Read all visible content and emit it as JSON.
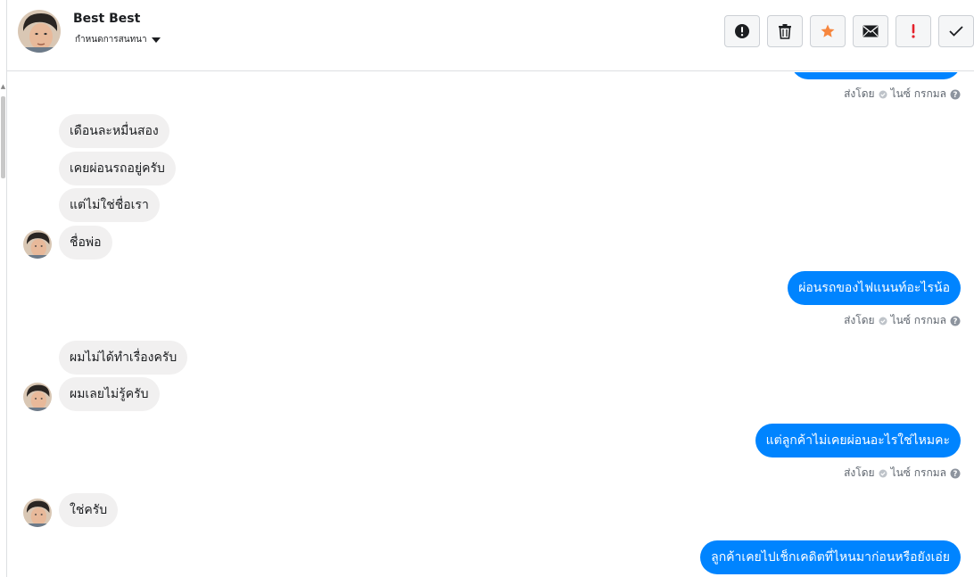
{
  "header": {
    "contact_name": "Best Best",
    "assign_label": "กำหนดการสนทนา"
  },
  "actions": [
    {
      "name": "spam-button",
      "icon": "exclamation-circle-icon"
    },
    {
      "name": "delete-button",
      "icon": "trash-icon"
    },
    {
      "name": "star-button",
      "icon": "star-icon"
    },
    {
      "name": "mark-unread-button",
      "icon": "envelope-icon"
    },
    {
      "name": "follow-up-button",
      "icon": "exclamation-icon"
    },
    {
      "name": "mark-done-button",
      "icon": "check-icon"
    }
  ],
  "colors": {
    "accent": "#0084ff",
    "incoming_bubble": "#f1f0f0",
    "star": "#f6863e",
    "follow_up": "#e4212b"
  },
  "messages": [
    {
      "from": "page",
      "text": "",
      "meta": {
        "sent_by": "ส่งโดย",
        "sender": "ไนซ์ กรกมล"
      }
    },
    {
      "from": "customer",
      "text": "เดือนละหมื่นสอง"
    },
    {
      "from": "customer",
      "text": "เคยผ่อนรถอยู่ครับ"
    },
    {
      "from": "customer",
      "text": "แต่ไม่ใช่ชื่อเรา"
    },
    {
      "from": "customer",
      "text": "ชื่อพ่อ"
    },
    {
      "from": "page",
      "text": "ผ่อนรถของไฟแนนท์อะไรน้อ",
      "meta": {
        "sent_by": "ส่งโดย",
        "sender": "ไนซ์ กรกมล"
      }
    },
    {
      "from": "customer",
      "text": "ผมไม่ได้ทำเรื่องครับ"
    },
    {
      "from": "customer",
      "text": "ผมเลยไม่รู้ครับ"
    },
    {
      "from": "page",
      "text": "แต่ลูกค้าไม่เคยผ่อนอะไรใช่ไหมคะ",
      "meta": {
        "sent_by": "ส่งโดย",
        "sender": "ไนซ์ กรกมล"
      }
    },
    {
      "from": "customer",
      "text": "ใช่ครับ"
    },
    {
      "from": "page",
      "text": "ลูกค้าเคยไปเช็กเคดิตที่ไหนมาก่อนหรือยังเอ่ย"
    }
  ]
}
